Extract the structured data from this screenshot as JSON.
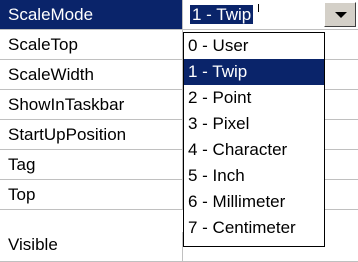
{
  "properties": [
    {
      "name": "ScaleMode",
      "selected": true
    },
    {
      "name": "ScaleTop"
    },
    {
      "name": "ScaleWidth"
    },
    {
      "name": "ShowInTaskbar"
    },
    {
      "name": "StartUpPosition"
    },
    {
      "name": "Tag"
    },
    {
      "name": "Top"
    },
    {
      "name": "Visible"
    }
  ],
  "current_value": "1 - Twip",
  "options": [
    "0 - User",
    "1 - Twip",
    "2 - Point",
    "3 - Pixel",
    "4 - Character",
    "5 - Inch",
    "6 - Millimeter",
    "7 - Centimeter"
  ],
  "selected_option_index": 1,
  "colors": {
    "selection": "#0a246a",
    "gridline": "#c0c0c0",
    "button_face": "#d4d0c8"
  },
  "icons": {
    "dropdown": "chevron-down-icon"
  }
}
